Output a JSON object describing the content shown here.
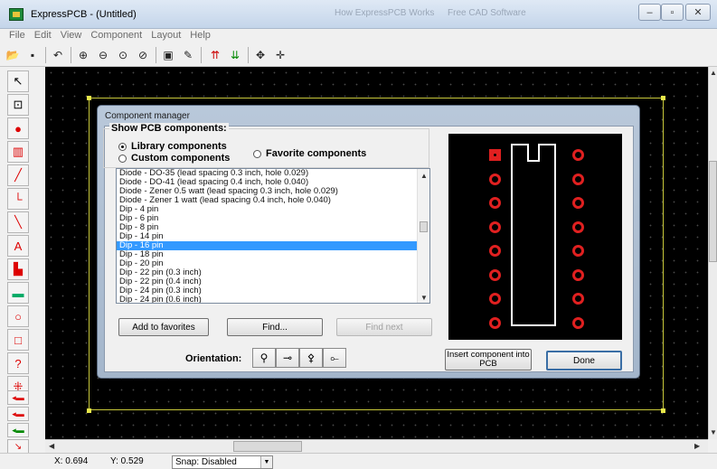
{
  "window": {
    "title": "ExpressPCB - (Untitled)",
    "ghost_left": "How ExpressPCB Works",
    "ghost_right": "Free CAD Software"
  },
  "menu": [
    "File",
    "Edit",
    "View",
    "Component",
    "Layout",
    "Help"
  ],
  "toolbar_icons": [
    "open-icon",
    "save-icon",
    "undo-icon",
    "zoom-in-icon",
    "zoom-out-icon",
    "zoom-window-icon",
    "zoom-fit-icon",
    "properties-icon",
    "erase-icon",
    "layer-top-icon",
    "layer-bottom-icon",
    "pan-icon",
    "move-icon"
  ],
  "palette_icons": [
    "pointer-icon",
    "component-icon",
    "pad-icon",
    "dip-icon",
    "trace-icon",
    "line-icon",
    "diagonal-icon",
    "text-icon",
    "fill-icon",
    "ground-plane-icon",
    "circle-icon",
    "rectangle-icon",
    "query-icon",
    "net-icon",
    "layer-1-icon",
    "layer-2-icon",
    "layer-3-icon",
    "power-icon"
  ],
  "dialog": {
    "title": "Component manager",
    "group_label": "Show PCB components:",
    "radio_library": "Library components",
    "radio_custom": "Custom components",
    "radio_favorite": "Favorite components",
    "selected_radio": "library",
    "list": [
      "Diode - DO-35  (lead spacing 0.3 inch, hole 0.029)",
      "Diode - DO-41  (lead spacing 0.4 inch, hole 0.040)",
      "Diode - Zener 0.5 watt  (lead spacing 0.3 inch, hole 0.029)",
      "Diode - Zener 1 watt  (lead spacing 0.4 inch, hole 0.040)",
      "Dip -  4 pin",
      "Dip -  6 pin",
      "Dip -  8 pin",
      "Dip - 14 pin",
      "Dip - 16 pin",
      "Dip - 18 pin",
      "Dip - 20 pin",
      "Dip - 22 pin  (0.3 inch)",
      "Dip - 22 pin  (0.4 inch)",
      "Dip - 24 pin  (0.3 inch)",
      "Dip - 24 pin  (0.6 inch)"
    ],
    "selected_index": 8,
    "btn_add_favorites": "Add to favorites",
    "btn_find": "Find...",
    "btn_find_next": "Find next",
    "orientation_label": "Orientation:",
    "btn_insert": "Insert component into PCB",
    "btn_done": "Done"
  },
  "status": {
    "x_coord": "X: 0.694",
    "y_coord": "Y: 0.529",
    "snap": "Snap:  Disabled"
  },
  "colors": {
    "canvas": "#000000",
    "pad": "#e02020",
    "board_outline": "#c8c83a",
    "selection": "#3399ff"
  }
}
